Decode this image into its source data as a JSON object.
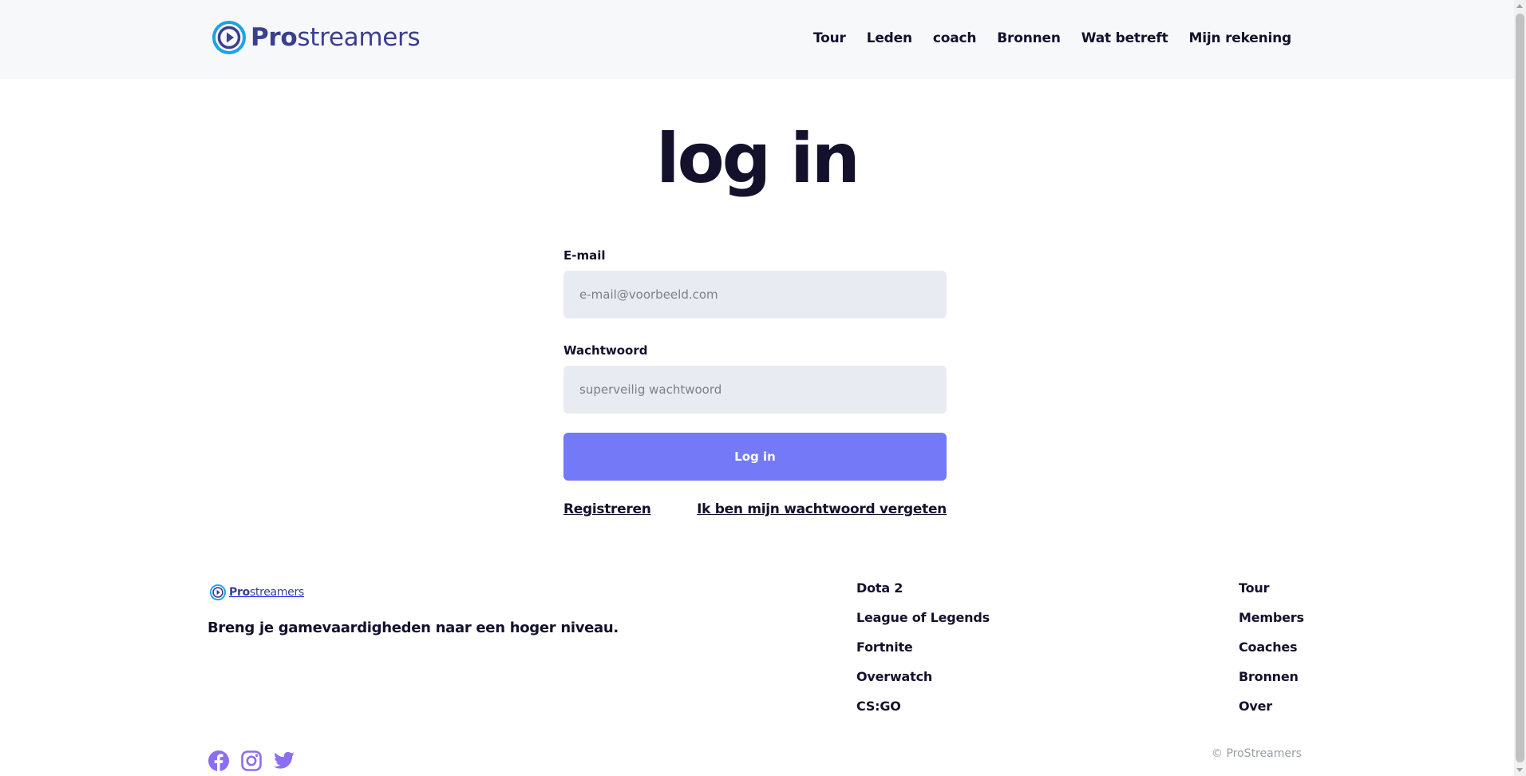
{
  "brand": {
    "name_pro": "Pro",
    "name_rest": "streamers",
    "color": "#3b3f8f",
    "accent": "#1aa3e8"
  },
  "nav": {
    "items": [
      {
        "label": "Tour"
      },
      {
        "label": "Leden"
      },
      {
        "label": "coach"
      },
      {
        "label": "Bronnen"
      },
      {
        "label": "Wat betreft"
      },
      {
        "label": "Mijn rekening"
      }
    ]
  },
  "page": {
    "title": "log in"
  },
  "form": {
    "email_label": "E-mail",
    "email_placeholder": "e-mail@voorbeeld.com",
    "password_label": "Wachtwoord",
    "password_placeholder": "superveilig wachtwoord",
    "submit_label": "Log in",
    "submit_color": "#7479f8",
    "register_label": "Registreren",
    "forgot_label": "Ik ben mijn wachtwoord vergeten"
  },
  "footer": {
    "tagline": "Breng je gamevaardigheden naar een hoger niveau.",
    "games": [
      "Dota 2",
      "League of Legends",
      "Fortnite",
      "Overwatch",
      "CS:GO"
    ],
    "links": [
      "Tour",
      "Members",
      "Coaches",
      "Bronnen",
      "Over"
    ],
    "social": [
      {
        "icon": "facebook-icon"
      },
      {
        "icon": "instagram-icon"
      },
      {
        "icon": "twitter-icon"
      }
    ],
    "social_color": "#8b6ff0",
    "copyright": "© ProStreamers"
  }
}
